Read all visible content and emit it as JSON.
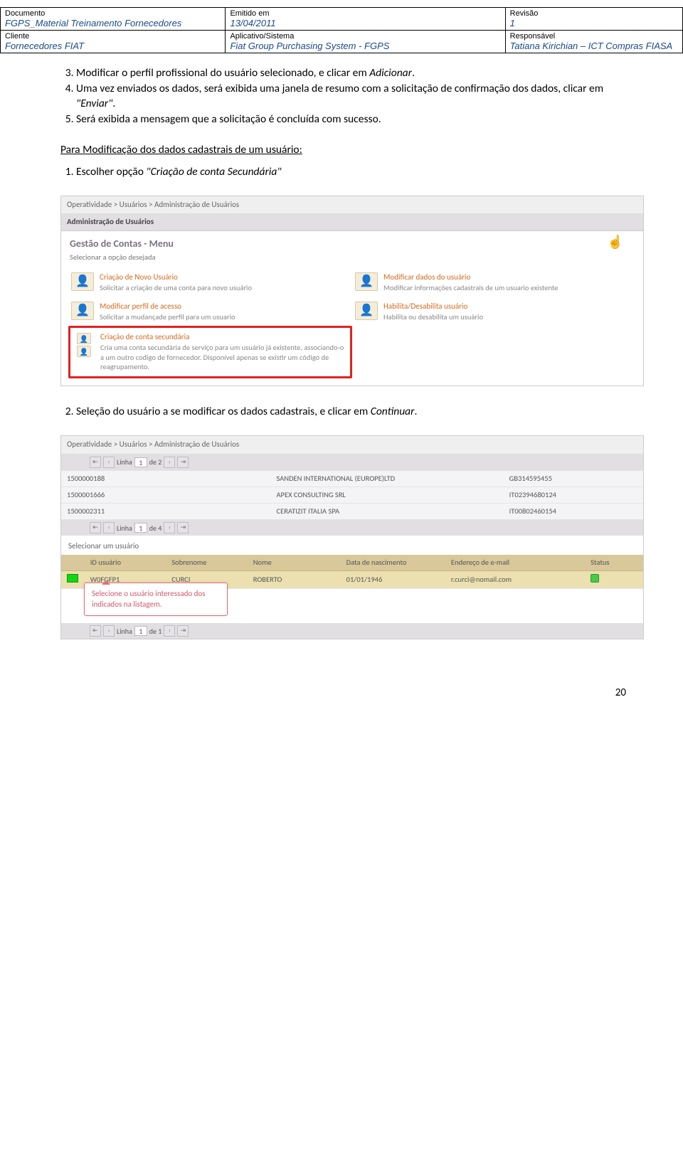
{
  "header": {
    "r1c1_label": "Documento",
    "r1c1_value": "FGPS_Material Treinamento Fornecedores",
    "r1c2_label": "Emitido em",
    "r1c2_value": "13/04/2011",
    "r1c3_label": "Revisão",
    "r1c3_value": "1",
    "r2c1_label": "Cliente",
    "r2c1_value": "Fornecedores FIAT",
    "r2c2_label": "Aplicativo/Sistema",
    "r2c2_value": "Fiat Group Purchasing System - FGPS",
    "r2c3_label": "Responsável",
    "r2c3_value": "Tatiana Kirichian – ICT Compras FIASA"
  },
  "body": {
    "li3a": "Modificar o perfil profissional do usuário selecionado, e clicar em ",
    "li3b": "Adicionar",
    "li3c": ".",
    "li4a": "Uma vez enviados os dados, será exibida uma janela de resumo com a solicitação de confirmação dos dados, clicar em ",
    "li4b": "\"Enviar\"",
    "li4c": ".",
    "li5": "Será exibida a mensagem que  a solicitação é concluída com sucesso.",
    "section_title": "Para Modificação dos dados cadastrais de um usuário:",
    "step1a": "Escolher opção ",
    "step1b": "\"Criação de conta Secundária\"",
    "step2a": "Seleção do usuário a se modificar os dados cadastrais, e clicar em ",
    "step2b": "Continuar",
    "step2c": "."
  },
  "shot1": {
    "breadcrumb": "Operatividade > Usuários > Administração de Usuários",
    "tab": "Administração de Usuários",
    "title": "Gestão de Contas - Menu",
    "subtitle": "Selecionar a opção desejada",
    "m1t": "Criação de Novo Usuário",
    "m1d": "Solicitar a criação de uma conta para novo usuário",
    "m2t": "Modificar dados do usuário",
    "m2d": "Modificar informações cadastrais de um usuario existente",
    "m3t": "Modificar perfil de acesso",
    "m3d": "Solicitar a mudançade perfil para um usuario",
    "m4t": "Habilita/Desabilita usuário",
    "m4d": "Habilita ou desabilita um usuário",
    "m5t": "Criação de conta secundária",
    "m5d": "Cria uma conta secundária de serviço para um usuário já existente, associando-o a um outro codigo de fornecedor. Disponível apenas se existir um código de reagrupamento."
  },
  "shot2": {
    "breadcrumb": "Operatividade > Usuários > Administração de Usuários",
    "pager1_line": "Linha",
    "pager1_of": "de 2",
    "pager1_val": "1",
    "rows1": [
      {
        "c1": "1500000188",
        "c2": "SANDEN INTERNATIONAL (EUROPE)LTD",
        "c3": "GB314595455"
      },
      {
        "c1": "1500001666",
        "c2": "APEX CONSULTING SRL",
        "c3": "IT02394680124"
      },
      {
        "c1": "1500002311",
        "c2": "CERATIZIT ITALIA SPA",
        "c3": "IT00802460154"
      }
    ],
    "pager2_of": "de 4",
    "pager2_val": "1",
    "section_label": "Selecionar um usuário",
    "th": {
      "c1": "ID usuário",
      "c2": "Sobrenome",
      "c3": "Nome",
      "c4": "Data de nascimento",
      "c5": "Endereço de e-mail",
      "c6": "Status"
    },
    "row2": {
      "c1": "W0FGFP1",
      "c2": "CURCI",
      "c3": "ROBERTO",
      "c4": "01/01/1946",
      "c5": "r.curci@nomail.com"
    },
    "callout": "Selecione o usuário interessado dos indicados na listagem.",
    "pager3_of": "de 1",
    "pager3_val": "1"
  },
  "page_number": "20"
}
